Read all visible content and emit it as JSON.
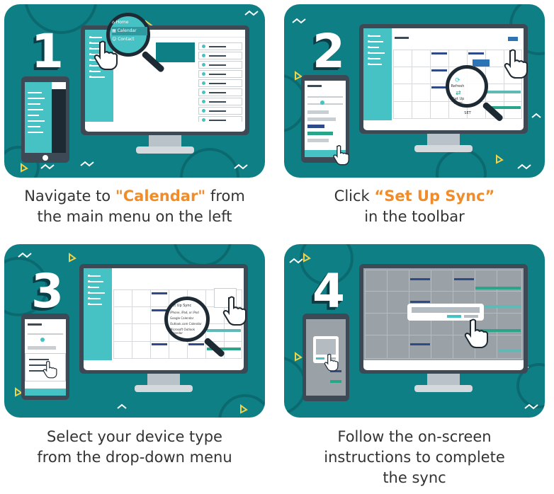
{
  "steps": [
    {
      "number": "1",
      "caption_pre": "Navigate to ",
      "caption_highlight": "\"Calendar\"",
      "caption_post": " from",
      "caption_line2": "the main menu on the left",
      "menu_items": [
        "Home",
        "Calendar",
        "Contact"
      ]
    },
    {
      "number": "2",
      "caption_pre": "Click ",
      "caption_highlight": "“Set Up Sync”",
      "caption_post": "",
      "caption_line2": "in the toolbar",
      "toolbar_items": [
        "Refresh",
        "Set Up Sync"
      ],
      "dialog_label": "SET"
    },
    {
      "number": "3",
      "caption_line1": "Select your device type",
      "caption_line2": "from the drop-down menu",
      "dropdown_header": "Set Up Sync",
      "dropdown_options": [
        "iPhone, iPad, or iPod",
        "Google Calendar",
        "Outlook.com Calendar",
        "Microsoft Outlook Calendar"
      ]
    },
    {
      "number": "4",
      "caption_line1": "Follow the on-screen",
      "caption_line2": "instructions to complete",
      "caption_line3": "the sync"
    }
  ],
  "colors": {
    "panel_bg": "#0f7f86",
    "accent_teal": "#46c1c4",
    "highlight_orange": "#f28c28",
    "number_shadow": "#0a3e47",
    "event_blue": "#2e4a8a",
    "event_green": "#2aa58a"
  },
  "icons": [
    "magnifier-icon",
    "pointer-hand-icon",
    "home-icon",
    "calendar-icon",
    "refresh-icon",
    "sync-icon"
  ]
}
